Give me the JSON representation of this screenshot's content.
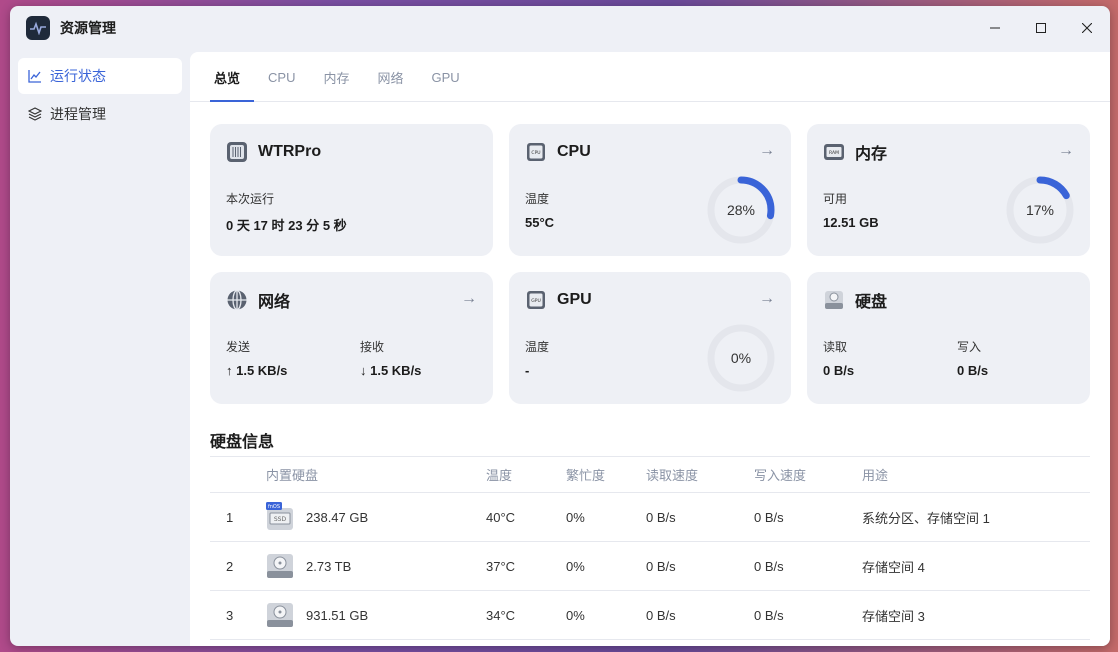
{
  "window": {
    "title": "资源管理"
  },
  "sidebar": {
    "items": [
      {
        "label": "运行状态",
        "icon": "chart-line-icon",
        "active": true
      },
      {
        "label": "进程管理",
        "icon": "layers-icon",
        "active": false
      }
    ]
  },
  "tabs": [
    {
      "label": "总览",
      "active": true
    },
    {
      "label": "CPU"
    },
    {
      "label": "内存"
    },
    {
      "label": "网络"
    },
    {
      "label": "GPU"
    }
  ],
  "cards": {
    "system": {
      "name": "WTRPro",
      "label": "本次运行",
      "value": "0 天 17 时 23 分 5 秒"
    },
    "cpu": {
      "name": "CPU",
      "label": "温度",
      "value": "55°C",
      "usage_text": "28%",
      "usage": 28
    },
    "memory": {
      "name": "内存",
      "label": "可用",
      "value": "12.51 GB",
      "usage_text": "17%",
      "usage": 17
    },
    "network": {
      "name": "网络",
      "send_label": "发送",
      "send_value": "↑ 1.5 KB/s",
      "recv_label": "接收",
      "recv_value": "↓ 1.5 KB/s"
    },
    "gpu": {
      "name": "GPU",
      "label": "温度",
      "value": "-",
      "usage_text": "0%",
      "usage": 0
    },
    "disk": {
      "name": "硬盘",
      "read_label": "读取",
      "read_value": "0 B/s",
      "write_label": "写入",
      "write_value": "0 B/s"
    }
  },
  "disk_section": {
    "title": "硬盘信息",
    "headers": [
      "内置硬盘",
      "温度",
      "繁忙度",
      "读取速度",
      "写入速度",
      "用途"
    ],
    "rows": [
      {
        "index": "1",
        "size": "238.47 GB",
        "temp": "40°C",
        "busy": "0%",
        "read": "0 B/s",
        "write": "0 B/s",
        "usage": "系统分区、存储空间 1",
        "icon": "ssd-icon",
        "badge": "fnOS",
        "ssd_label": "SSD"
      },
      {
        "index": "2",
        "size": "2.73 TB",
        "temp": "37°C",
        "busy": "0%",
        "read": "0 B/s",
        "write": "0 B/s",
        "usage": "存储空间 4",
        "icon": "hdd-icon"
      },
      {
        "index": "3",
        "size": "931.51 GB",
        "temp": "34°C",
        "busy": "0%",
        "read": "0 B/s",
        "write": "0 B/s",
        "usage": "存储空间 3",
        "icon": "hdd-icon"
      }
    ]
  },
  "colors": {
    "accent": "#3a64d8",
    "ring_track": "#e4e6ec"
  }
}
